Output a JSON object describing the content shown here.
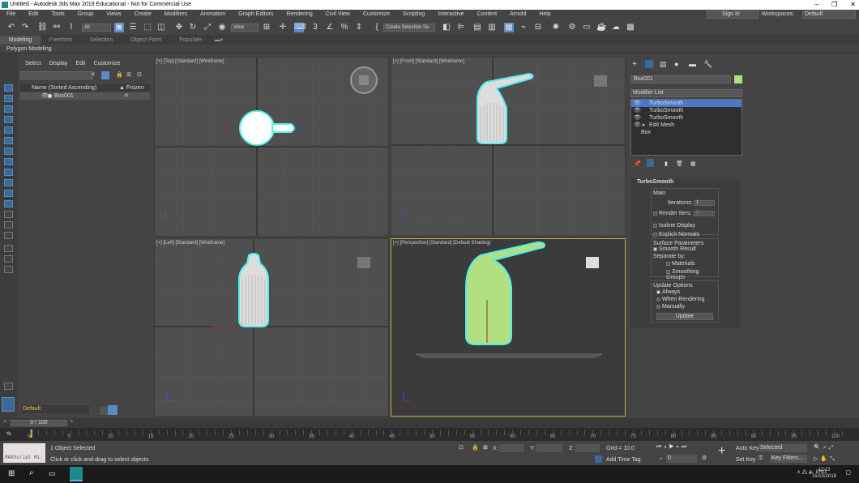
{
  "title": "Untitled - Autodesk 3ds Max 2019 Educational - Not for Commercial Use",
  "menu": [
    "File",
    "Edit",
    "Tools",
    "Group",
    "Views",
    "Create",
    "Modifiers",
    "Animation",
    "Graph Editors",
    "Rendering",
    "Civil View",
    "Customize",
    "Scripting",
    "Interactive",
    "Content",
    "Arnold",
    "Help"
  ],
  "signin": "Sign In",
  "workspaces_label": "Workspaces:",
  "workspaces_value": "Default",
  "toolbar": {
    "filter": "All",
    "view": "View",
    "selection_set": "Create Selection Se"
  },
  "ribbon_tabs": [
    "Modeling",
    "Freeform",
    "Selection",
    "Object Paint",
    "Populate"
  ],
  "ribbon_sub": "Polygon Modeling",
  "explorer": {
    "tabs": [
      "Select",
      "Display",
      "Edit",
      "Customize"
    ],
    "col_name": "Name (Sorted Ascending)",
    "col_frozen": "▲ Frozen",
    "row": "Box001",
    "layer": "Default"
  },
  "viewports": {
    "top": "[+] [Top] [Standard] [Wireframe]",
    "front": "[+] [Front] [Standard] [Wireframe]",
    "left": "[+] [Left] [Standard] [Wireframe]",
    "persp": "[+] [Perspective] [Standard] [Default Shading]"
  },
  "cmd": {
    "object_name": "Box001",
    "modifier_list": "Modifier List",
    "stack": [
      "TurboSmooth",
      "TurboSmooth",
      "TurboSmooth",
      "Edit Mesh",
      "Box"
    ],
    "rollout_title": "TurboSmooth",
    "main": "Main",
    "iterations_label": "Iterations:",
    "iterations": "1",
    "render_iters_label": "Render Iters:",
    "render_iters": "0",
    "isoline": "Isoline Display",
    "explicit": "Explicit Normals",
    "surface_params": "Surface Parameters",
    "smooth_result": "Smooth Result",
    "separate_by": "Separate by:",
    "materials": "Materials",
    "smoothing_groups": "Smoothing Groups",
    "update_options": "Update Options",
    "always": "Always",
    "when_rendering": "When Rendering",
    "manually": "Manually",
    "update": "Update"
  },
  "timeslider": "0 / 100",
  "ticks": [
    "0",
    "5",
    "10",
    "15",
    "20",
    "25",
    "30",
    "35",
    "40",
    "45",
    "50",
    "55",
    "60",
    "65",
    "70",
    "75",
    "80",
    "85",
    "90",
    "95",
    "100"
  ],
  "status": {
    "selected": "1 Object Selected",
    "prompt": "Click or click-and-drag to select objects",
    "maxscript": "MAXScript Mi:",
    "x": "X:",
    "y": "Y:",
    "z": "Z:",
    "grid": "Grid = 10.0",
    "add_time_tag": "Add Time Tag",
    "frame": "0",
    "auto_key": "Auto Key",
    "set_key": "Set Key",
    "selected_dd": "Selected",
    "key_filters": "Key Filters..."
  },
  "taskbar": {
    "lang": "ENG",
    "time": "12:13",
    "date": "15/10/2018"
  },
  "colors": {
    "accent": "#4b78c8",
    "object": "#b0e080",
    "selection_outline": "#4ff0f0"
  }
}
